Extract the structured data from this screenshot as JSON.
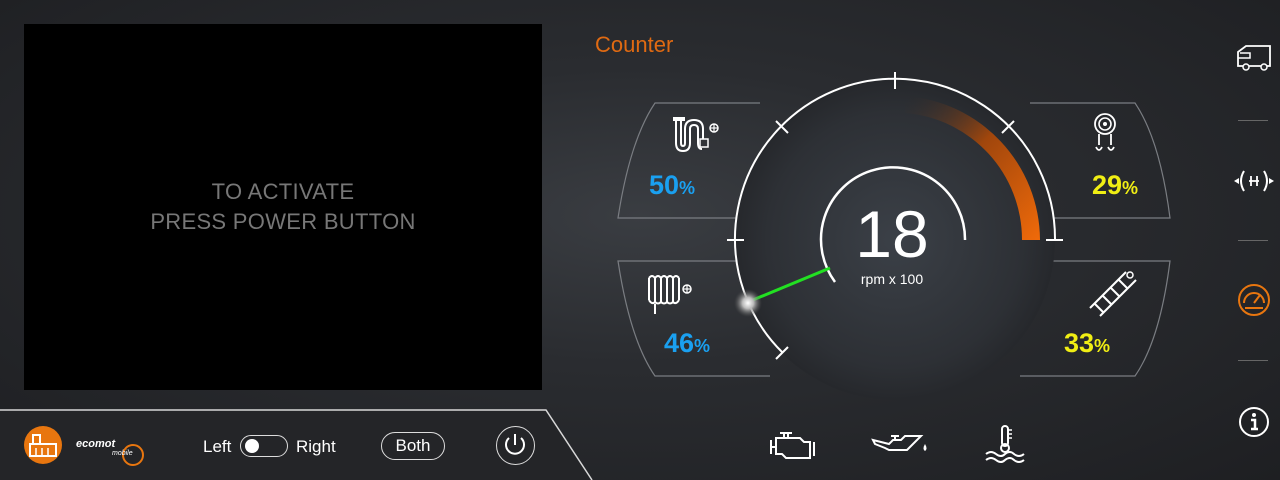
{
  "camera": {
    "message_line1": "TO ACTIVATE",
    "message_line2": "PRESS POWER BUTTON"
  },
  "page_title": "Counter",
  "gauge": {
    "value": "18",
    "unit": "rpm x 100",
    "needle_value": 18,
    "max": 100
  },
  "tiles": {
    "top_left": {
      "value": "50",
      "unit": "%",
      "icon": "hydraulic-hose-icon"
    },
    "bottom_left": {
      "value": "46",
      "unit": "%",
      "icon": "heater-icon"
    },
    "top_right": {
      "value": "29",
      "unit": "%",
      "icon": "cable-reel-icon"
    },
    "bottom_right": {
      "value": "33",
      "unit": "%",
      "icon": "ladder-icon"
    }
  },
  "bottom_bar": {
    "left_label": "Left",
    "right_label": "Right",
    "both_label": "Both",
    "brand_text": "ecomot",
    "brand_sub": "mobile"
  },
  "warning_icons": [
    "engine-icon",
    "oil-pressure-icon",
    "coolant-temperature-icon"
  ],
  "sidebar": [
    "vehicle-icon",
    "brake-icon",
    "speedometer-icon",
    "info-icon"
  ],
  "colors": {
    "accent": "#e06a12",
    "blue_value": "#1aa0f0",
    "yellow_value": "#f0ee14",
    "needle": "#22e022"
  }
}
